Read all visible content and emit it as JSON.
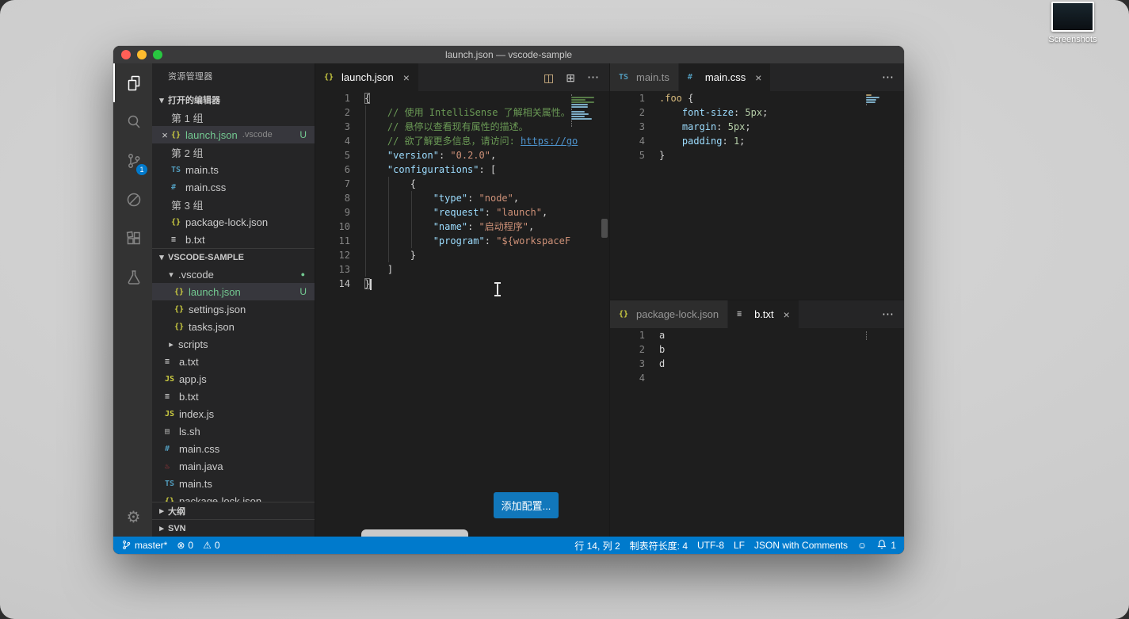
{
  "colors": {
    "accent": "#007acc",
    "statusbar": "#007acc",
    "editor_bg": "#1e1e1e",
    "sidebar_bg": "#252526",
    "activitybar_bg": "#333333",
    "titlebar_bg": "#3a3a3b",
    "selection_bg": "#37373d",
    "git_untracked": "#73c991",
    "button_bg": "#1177bb",
    "fg": "#d4d4d4",
    "comment": "#6a9955",
    "key": "#9cdcfe",
    "string": "#ce9178",
    "number": "#b5cea8",
    "css_class": "#d7ba7d",
    "link": "#4e94ce"
  },
  "desktop": {
    "screenshots_label": "Screenshots"
  },
  "window": {
    "title": "launch.json — vscode-sample"
  },
  "activity_bar": {
    "top": [
      {
        "icon": "files",
        "name": "explorer",
        "active": true
      },
      {
        "icon": "search",
        "name": "search"
      },
      {
        "icon": "source-control",
        "name": "source-control",
        "badge": "1"
      },
      {
        "icon": "circle-slash",
        "name": "circle-slash"
      },
      {
        "icon": "extensions",
        "name": "extensions"
      },
      {
        "icon": "beaker",
        "name": "testing"
      }
    ],
    "bottom": [
      {
        "icon": "gear",
        "name": "manage"
      }
    ]
  },
  "sidebar": {
    "title": "资源管理器",
    "open_editors_label": "打开的编辑器",
    "open_editors": [
      {
        "type": "group",
        "label": "第 1 组"
      },
      {
        "type": "file",
        "icon": "json",
        "label": "launch.json",
        "detail": ".vscode",
        "badge": "U",
        "selected": true,
        "close": true,
        "green": true
      },
      {
        "type": "group",
        "label": "第 2 组"
      },
      {
        "type": "file",
        "icon": "ts",
        "label": "main.ts"
      },
      {
        "type": "file",
        "icon": "css",
        "label": "main.css"
      },
      {
        "type": "group",
        "label": "第 3 组"
      },
      {
        "type": "file",
        "icon": "json",
        "label": "package-lock.json"
      },
      {
        "type": "file",
        "icon": "txt",
        "label": "b.txt"
      }
    ],
    "workspace_label": "VSCODE-SAMPLE",
    "tree": [
      {
        "type": "folder",
        "label": ".vscode",
        "expanded": true,
        "indent": 0,
        "dot": true
      },
      {
        "type": "file",
        "icon": "json",
        "label": "launch.json",
        "indent": 1,
        "badge": "U",
        "selected": true,
        "green": true
      },
      {
        "type": "file",
        "icon": "json",
        "label": "settings.json",
        "indent": 1
      },
      {
        "type": "file",
        "icon": "json",
        "label": "tasks.json",
        "indent": 1
      },
      {
        "type": "folder",
        "label": "scripts",
        "expanded": false,
        "indent": 0
      },
      {
        "type": "file",
        "icon": "txt",
        "label": "a.txt",
        "indent": 0
      },
      {
        "type": "file",
        "icon": "js",
        "label": "app.js",
        "indent": 0
      },
      {
        "type": "file",
        "icon": "txt",
        "label": "b.txt",
        "indent": 0
      },
      {
        "type": "file",
        "icon": "js",
        "label": "index.js",
        "indent": 0
      },
      {
        "type": "file",
        "icon": "sh",
        "label": "ls.sh",
        "indent": 0
      },
      {
        "type": "file",
        "icon": "css",
        "label": "main.css",
        "indent": 0
      },
      {
        "type": "file",
        "icon": "java",
        "label": "main.java",
        "indent": 0
      },
      {
        "type": "file",
        "icon": "ts",
        "label": "main.ts",
        "indent": 0
      },
      {
        "type": "file",
        "icon": "json",
        "label": "package-lock.json",
        "indent": 0
      }
    ],
    "bottom_sections": [
      "大纲",
      "SVN"
    ]
  },
  "editor_groups": [
    {
      "name": "launch-json-editor-group",
      "tabs": [
        {
          "icon": "json",
          "label": "launch.json",
          "active": true,
          "close": true
        }
      ],
      "actions": [
        {
          "name": "split-editor"
        },
        {
          "name": "toggle-layout"
        },
        {
          "name": "more-actions"
        }
      ],
      "active_line": 14,
      "indent_guides": true,
      "scroll_thumb": true,
      "partial_widget": true,
      "overlay_button": "添加配置...",
      "code": [
        {
          "tokens": [
            [
              "{",
              "fg",
              "box"
            ]
          ]
        },
        {
          "tokens": [
            [
              "    ",
              ""
            ],
            [
              "// 使用 IntelliSense 了解相关属性。",
              "comment"
            ]
          ]
        },
        {
          "tokens": [
            [
              "    ",
              ""
            ],
            [
              "// 悬停以查看现有属性的描述。",
              "comment"
            ]
          ]
        },
        {
          "tokens": [
            [
              "    ",
              ""
            ],
            [
              "// 欲了解更多信息，请访问: ",
              "comment"
            ],
            [
              "https://go",
              "link"
            ]
          ]
        },
        {
          "tokens": [
            [
              "    ",
              ""
            ],
            [
              "\"version\"",
              "key"
            ],
            [
              ": ",
              ""
            ],
            [
              "\"0.2.0\"",
              "str"
            ],
            [
              ",",
              ""
            ]
          ]
        },
        {
          "tokens": [
            [
              "    ",
              ""
            ],
            [
              "\"configurations\"",
              "key"
            ],
            [
              ": [",
              ""
            ]
          ]
        },
        {
          "tokens": [
            [
              "        {",
              ""
            ]
          ]
        },
        {
          "tokens": [
            [
              "            ",
              ""
            ],
            [
              "\"type\"",
              "key"
            ],
            [
              ": ",
              ""
            ],
            [
              "\"node\"",
              "str"
            ],
            [
              ",",
              ""
            ]
          ]
        },
        {
          "tokens": [
            [
              "            ",
              ""
            ],
            [
              "\"request\"",
              "key"
            ],
            [
              ": ",
              ""
            ],
            [
              "\"launch\"",
              "str"
            ],
            [
              ",",
              ""
            ]
          ]
        },
        {
          "tokens": [
            [
              "            ",
              ""
            ],
            [
              "\"name\"",
              "key"
            ],
            [
              ": ",
              ""
            ],
            [
              "\"启动程序\"",
              "str"
            ],
            [
              ",",
              ""
            ]
          ]
        },
        {
          "tokens": [
            [
              "            ",
              ""
            ],
            [
              "\"program\"",
              "key"
            ],
            [
              ": ",
              ""
            ],
            [
              "\"${workspaceF",
              "str"
            ]
          ]
        },
        {
          "tokens": [
            [
              "        }",
              ""
            ]
          ]
        },
        {
          "tokens": [
            [
              "    ]",
              ""
            ]
          ]
        },
        {
          "tokens": [
            [
              "}",
              "fg",
              "box"
            ]
          ],
          "caret": true
        }
      ]
    },
    {
      "name": "main-css-editor-group",
      "tabs": [
        {
          "icon": "ts",
          "label": "main.ts"
        },
        {
          "icon": "css",
          "label": "main.css",
          "active": true,
          "close": true
        }
      ],
      "actions": [
        {
          "name": "more-actions"
        }
      ],
      "code": [
        {
          "tokens": [
            [
              ".foo",
              "csssel"
            ],
            [
              " {",
              ""
            ]
          ]
        },
        {
          "tokens": [
            [
              "    ",
              ""
            ],
            [
              "font-size",
              "key"
            ],
            [
              ": ",
              ""
            ],
            [
              "5px",
              "num"
            ],
            [
              ";",
              ""
            ]
          ]
        },
        {
          "tokens": [
            [
              "    ",
              ""
            ],
            [
              "margin",
              "key"
            ],
            [
              ": ",
              ""
            ],
            [
              "5px",
              "num"
            ],
            [
              ";",
              ""
            ]
          ]
        },
        {
          "tokens": [
            [
              "    ",
              ""
            ],
            [
              "padding",
              "key"
            ],
            [
              ": ",
              ""
            ],
            [
              "1",
              "num"
            ],
            [
              ";",
              ""
            ]
          ]
        },
        {
          "tokens": [
            [
              "}",
              ""
            ]
          ]
        }
      ]
    },
    {
      "name": "b-txt-editor-group",
      "tabs": [
        {
          "icon": "json",
          "label": "package-lock.json"
        },
        {
          "icon": "txt",
          "label": "b.txt",
          "active": true,
          "close": true
        }
      ],
      "actions": [
        {
          "name": "more-actions"
        }
      ],
      "code": [
        {
          "tokens": [
            [
              "a",
              ""
            ]
          ]
        },
        {
          "tokens": [
            [
              "b",
              ""
            ]
          ]
        },
        {
          "tokens": [
            [
              "d",
              ""
            ]
          ]
        },
        {
          "tokens": [
            [
              "",
              ""
            ]
          ]
        }
      ]
    }
  ],
  "status_bar": {
    "branch": "master*",
    "errors": "0",
    "warnings": "0",
    "right_items": [
      "行 14, 列 2",
      "制表符长度: 4",
      "UTF-8",
      "LF",
      "JSON with Comments"
    ],
    "notifications": "1"
  }
}
